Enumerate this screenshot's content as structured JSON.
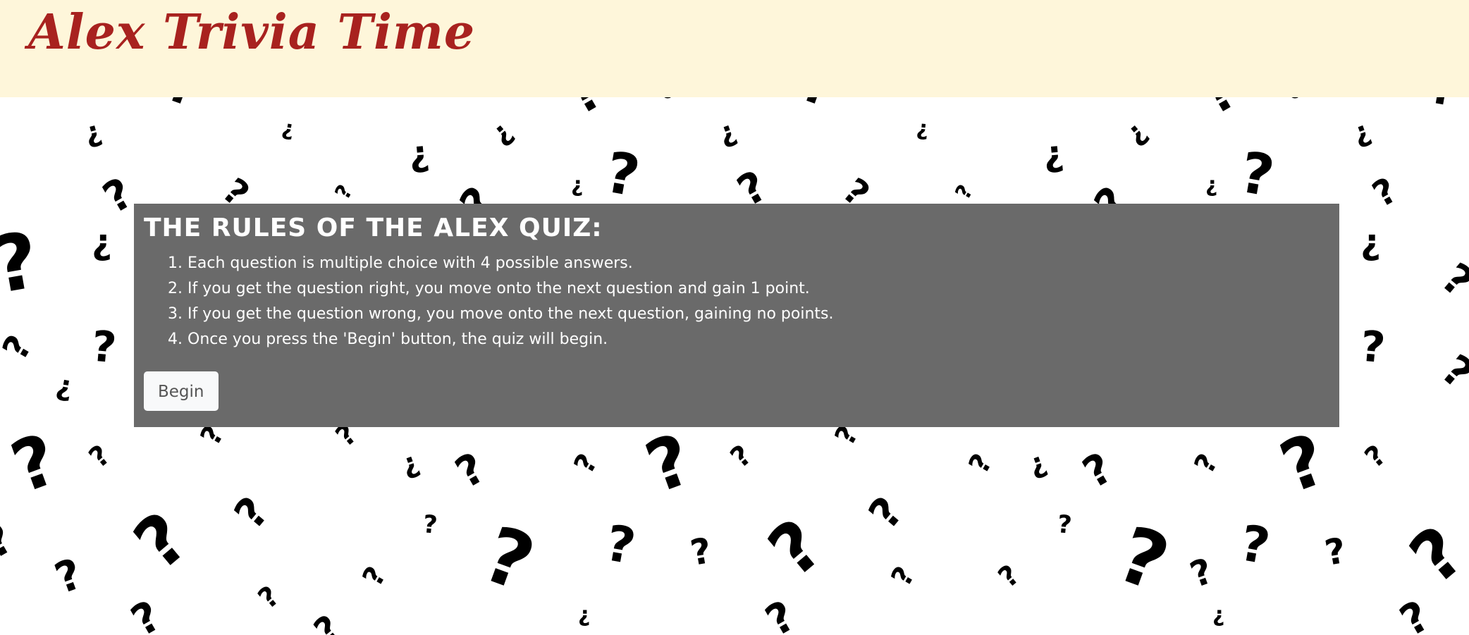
{
  "header": {
    "title": "Alex Trivia Time"
  },
  "background": {
    "pattern_icon": "question-mark-icon",
    "glyphs": [
      "?",
      "¿"
    ]
  },
  "rules": {
    "heading": "The rules of the Alex Quiz:",
    "items": [
      "Each question is multiple choice with 4 possible answers.",
      "If you get the question right, you move onto the next question and gain 1 point.",
      "If you get the question wrong, you move onto the next question, gaining no points.",
      "Once you press the 'Begin' button, the quiz will begin."
    ],
    "begin_label": "Begin"
  },
  "colors": {
    "header_bg": "#fef6da",
    "title": "#a8221f",
    "panel_bg": "#6a6a6a",
    "button_bg": "#f8f9fa"
  }
}
